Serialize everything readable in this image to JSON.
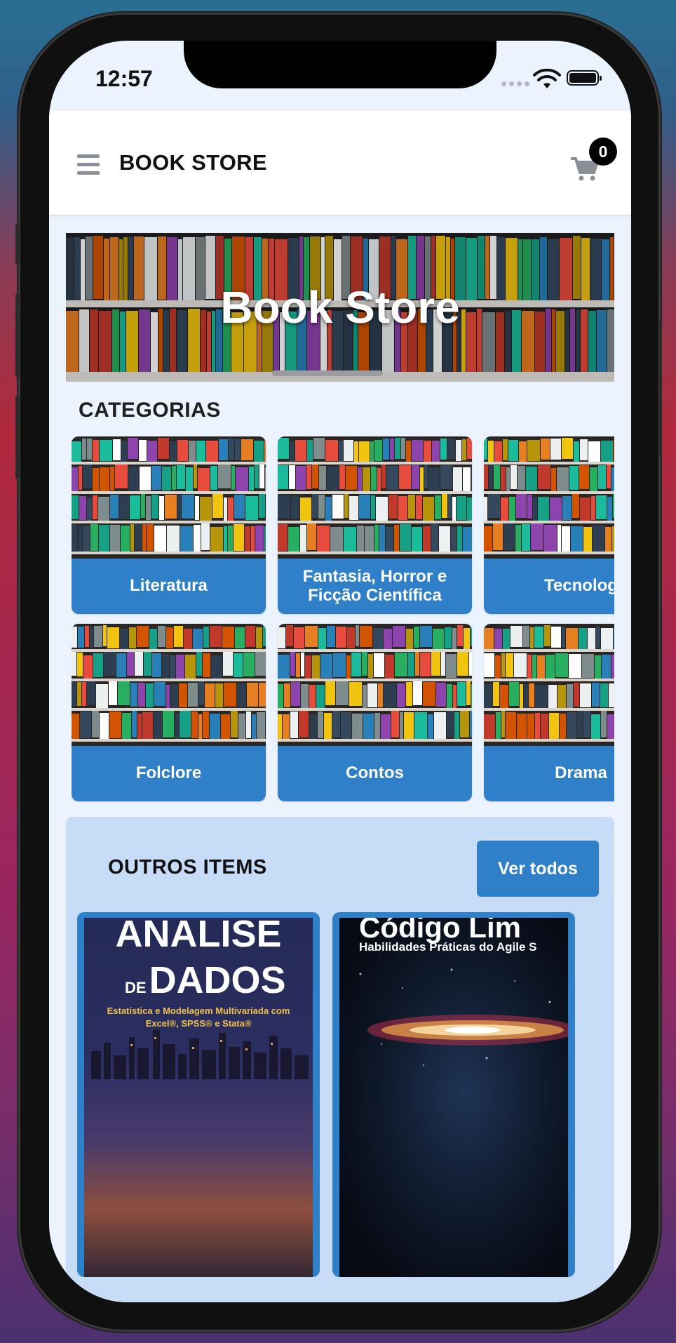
{
  "status_bar": {
    "time": "12:57"
  },
  "app_bar": {
    "title": "BOOK STORE",
    "cart_count": "0"
  },
  "banner": {
    "title": "Book Store"
  },
  "categories": {
    "title": "CATEGORIAS",
    "items": [
      {
        "label": "Literatura"
      },
      {
        "label": "Fantasia, Horror e Ficção Científica"
      },
      {
        "label": "Tecnolog"
      },
      {
        "label": "Folclore"
      },
      {
        "label": "Contos"
      },
      {
        "label": "Drama"
      }
    ]
  },
  "others": {
    "title": "OUTROS ITEMS",
    "button_label": "Ver todos",
    "products": [
      {
        "cover_line1": "ANALISE",
        "cover_line2_prefix": "DE",
        "cover_line2": "DADOS",
        "cover_subtitle": "Estatística e Modelagem Multivariada com Excel®, SPSS® e Stata®"
      },
      {
        "cover_title": "Código Lim",
        "cover_subtitle": "Habilidades Práticas do Agile S"
      }
    ]
  },
  "colors": {
    "accent": "#2f80c9",
    "screen_background": "#ebf3ff",
    "others_background": "#c7dcf7"
  },
  "icons": [
    "menu-icon",
    "cart-icon",
    "wifi-icon",
    "battery-icon"
  ]
}
